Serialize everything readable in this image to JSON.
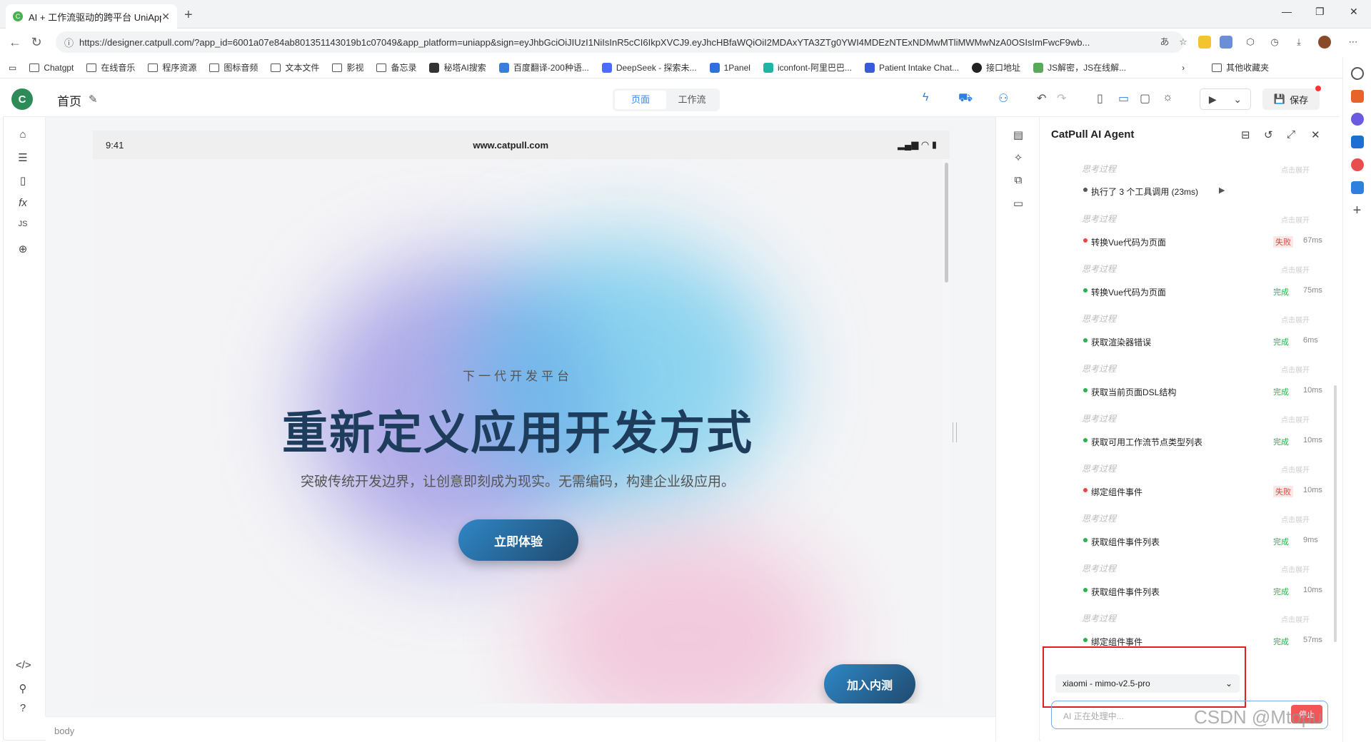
{
  "browser": {
    "tab_title": "AI + 工作流驱动的跨平台 UniApp",
    "url": "https://designer.catpull.com/?app_id=6001a07e84ab801351143019b1c07049&app_platform=uniapp&sign=eyJhbGciOiJIUzI1NiIsInR5cCI6IkpXVCJ9.eyJhcHBfaWQiOiI2MDAxYTA3ZTg0YWI4MDEzNTExNDMwMTliMWMwNzA0OSIsImFwcF9wb...",
    "bookmarks": [
      "Chatgpt",
      "在线音乐",
      "程序资源",
      "图标音频",
      "文本文件",
      "影视",
      "备忘录",
      "秘塔AI搜索",
      "百度翻译-200种语...",
      "DeepSeek - 探索未...",
      "1Panel",
      "iconfont-阿里巴巴...",
      "Patient Intake Chat...",
      "接口地址",
      "JS解密，JS在线解..."
    ],
    "other_bookmarks": "其他收藏夹"
  },
  "app": {
    "logo_letter": "C",
    "page_title": "首页",
    "segments": [
      "页面",
      "工作流"
    ],
    "save_label": "保存",
    "footer_path": "body"
  },
  "device": {
    "time": "9:41",
    "url": "www.catpull.com",
    "eyebrow": "下一代开发平台",
    "headline": "重新定义应用开发方式",
    "subline": "突破传统开发边界，让创意即刻成为现实。无需编码，构建企业级应用。",
    "cta": "立即体验",
    "beta": "加入内测"
  },
  "agent": {
    "title": "CatPull AI Agent",
    "think_label": "思考过程",
    "think_hint": "点击展开",
    "summary": "执行了 3 个工具调用 (23ms)",
    "tools": [
      {
        "label": "转换Vue代码为页面",
        "status": "失败",
        "ok": false,
        "ms": "67ms"
      },
      {
        "label": "转换Vue代码为页面",
        "status": "完成",
        "ok": true,
        "ms": "75ms"
      },
      {
        "label": "获取渲染器错误",
        "status": "完成",
        "ok": true,
        "ms": "6ms"
      },
      {
        "label": "获取当前页面DSL结构",
        "status": "完成",
        "ok": true,
        "ms": "10ms"
      },
      {
        "label": "获取可用工作流节点类型列表",
        "status": "完成",
        "ok": true,
        "ms": "10ms"
      },
      {
        "label": "绑定组件事件",
        "status": "失败",
        "ok": false,
        "ms": "10ms"
      },
      {
        "label": "获取组件事件列表",
        "status": "完成",
        "ok": true,
        "ms": "9ms"
      },
      {
        "label": "获取组件事件列表",
        "status": "完成",
        "ok": true,
        "ms": "10ms"
      },
      {
        "label": "绑定组件事件",
        "status": "完成",
        "ok": true,
        "ms": "57ms"
      }
    ],
    "model": "xiaomi - mimo-v2.5-pro",
    "input_placeholder": "AI 正在处理中...",
    "send_label": "停止",
    "colors": {
      "ok": "#27b24a",
      "fail": "#f04040",
      "highlight": "#e02020"
    }
  },
  "watermark": "CSDN @Mtopu"
}
